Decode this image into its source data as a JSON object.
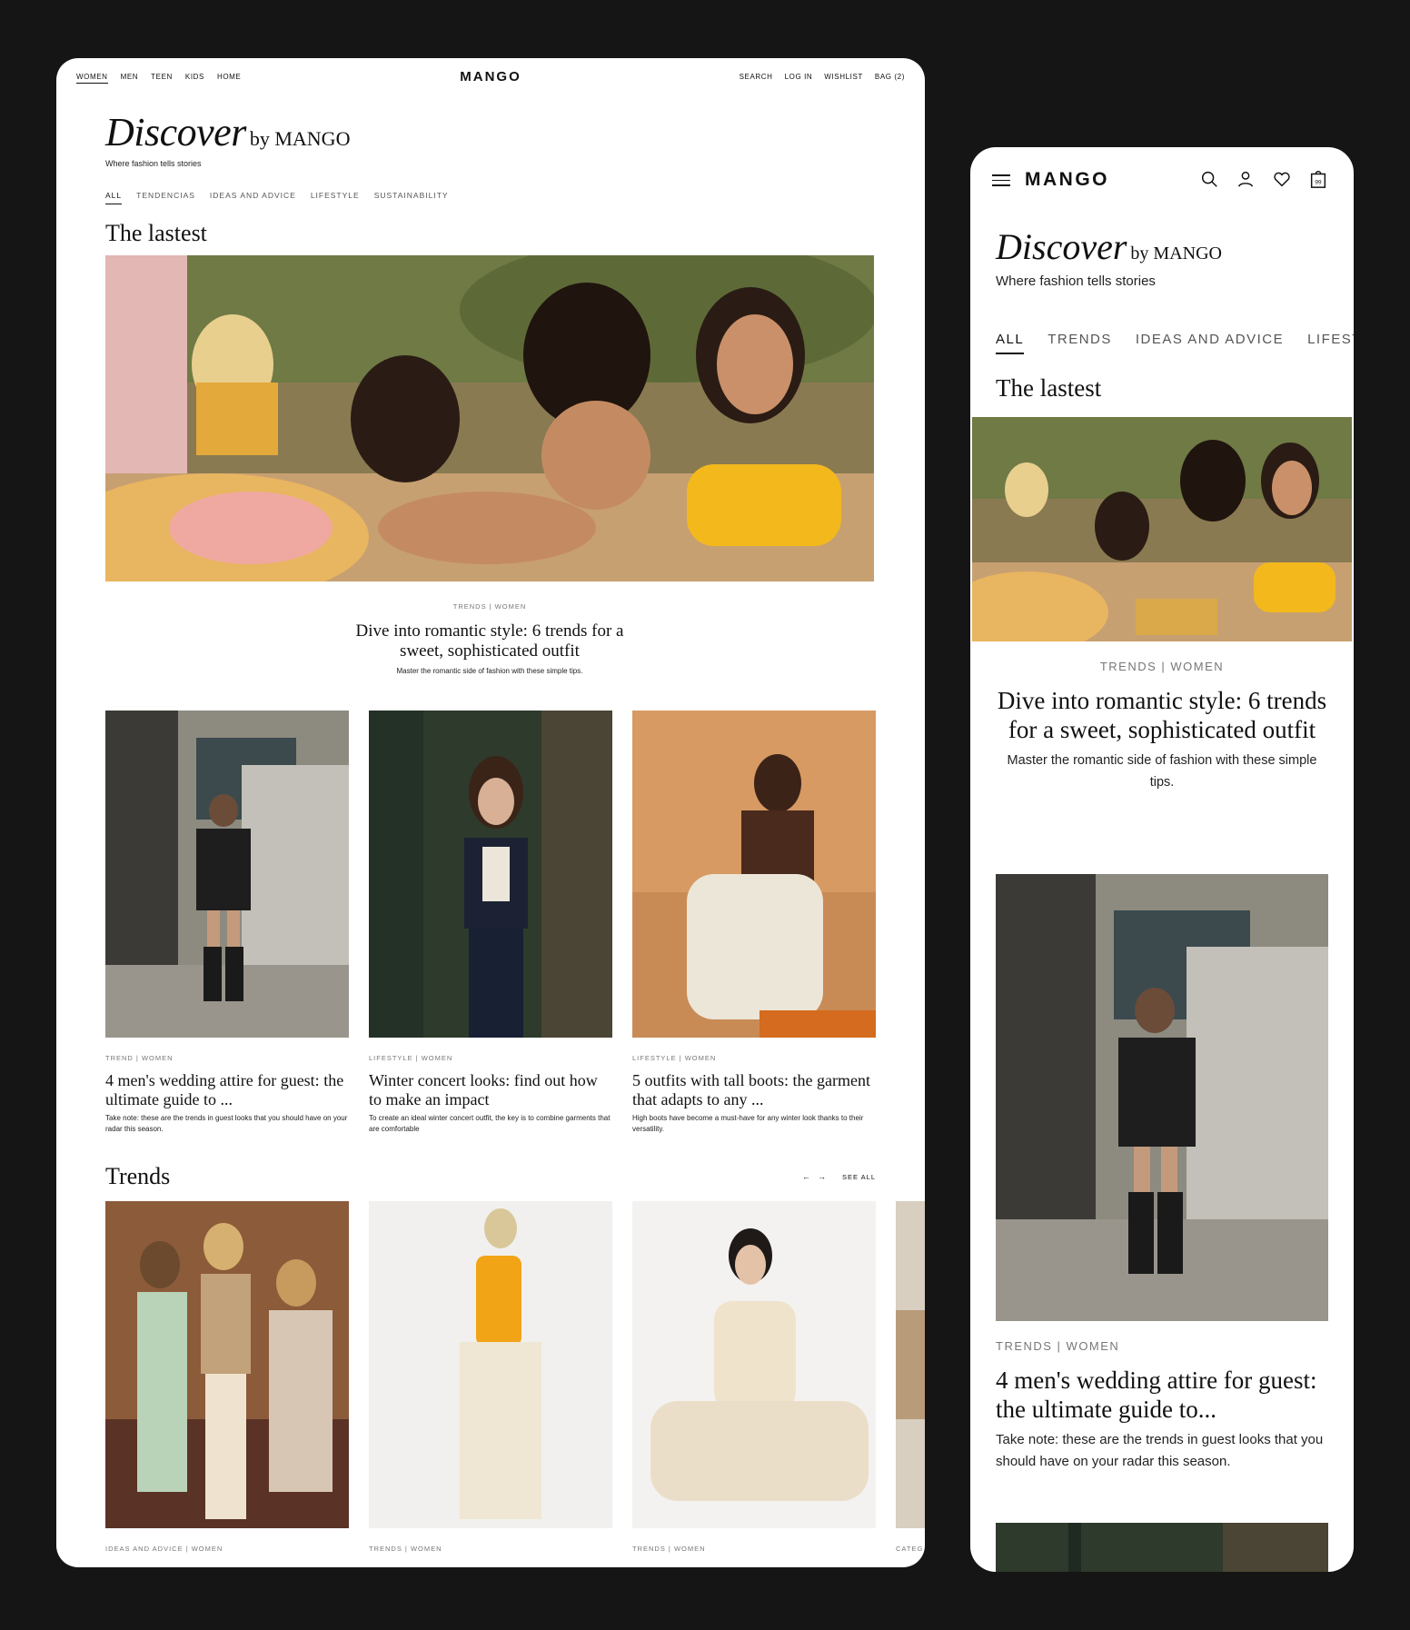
{
  "desktop": {
    "nav_left": [
      "WOMEN",
      "MEN",
      "TEEN",
      "KIDS",
      "HOME"
    ],
    "logo": "MANGO",
    "nav_right": [
      "SEARCH",
      "LOG IN",
      "WISHLIST",
      "BAG (2)"
    ],
    "brand": {
      "discover": "Discover",
      "by": "by MANGO",
      "tagline": "Where fashion tells stories"
    },
    "tabs": [
      "ALL",
      "TENDENCIAS",
      "IDEAS AND ADVICE",
      "LIFESTYLE",
      "SUSTAINABILITY"
    ],
    "section_latest": "The lastest",
    "hero": {
      "cats": "TRENDS  |  WOMEN",
      "title": "Dive into romantic style: 6 trends for a sweet, sophisticated outfit",
      "desc": "Master the romantic side of fashion with these simple tips."
    },
    "cards": [
      {
        "cats": "TREND  |  WOMEN",
        "title": "4 men's wedding attire for guest: the ultimate guide to ...",
        "desc": "Take note: these are the trends in guest looks that you should have on your radar this season."
      },
      {
        "cats": "LIFESTYLE  |  WOMEN",
        "title": "Winter concert looks: find out how to make an impact",
        "desc": "To create an ideal winter concert outfit, the key is to combine garments that are comfortable"
      },
      {
        "cats": "LIFESTYLE  |  WOMEN",
        "title": "5 outfits with tall boots: the garment that adapts to any ...",
        "desc": "High boots have become a must-have for any winter look thanks to their versatility."
      }
    ],
    "section_trends": "Trends",
    "see_all": "SEE ALL",
    "arrow_prev": "←",
    "arrow_next": "→",
    "trend_cards": [
      {
        "cats": "IDEAS AND ADVICE  |  WOMEN"
      },
      {
        "cats": "TRENDS  |  WOMEN"
      },
      {
        "cats": "TRENDS  |  WOMEN"
      },
      {
        "cats": "CATEG"
      }
    ]
  },
  "mobile": {
    "logo": "MANGO",
    "bag_count": "99",
    "brand": {
      "discover": "Discover",
      "by": "by MANGO",
      "tagline": "Where fashion tells stories"
    },
    "tabs": [
      "ALL",
      "TRENDS",
      "IDEAS AND ADVICE",
      "LIFESTY"
    ],
    "section_latest": "The lastest",
    "hero": {
      "cats": "TRENDS  |  WOMEN",
      "title": "Dive into romantic style: 6 trends for a sweet, sophisticated outfit",
      "desc": "Master the romantic side of fashion with these simple tips."
    },
    "card": {
      "cats": "TRENDS  |  WOMEN",
      "title": "4 men's wedding attire for guest: the ultimate guide to...",
      "desc": "Take note: these are the trends in guest looks that you should have on your radar this season."
    }
  },
  "colors": {
    "background": "#151515",
    "surface": "#ffffff",
    "text": "#111111",
    "muted": "#777777"
  }
}
